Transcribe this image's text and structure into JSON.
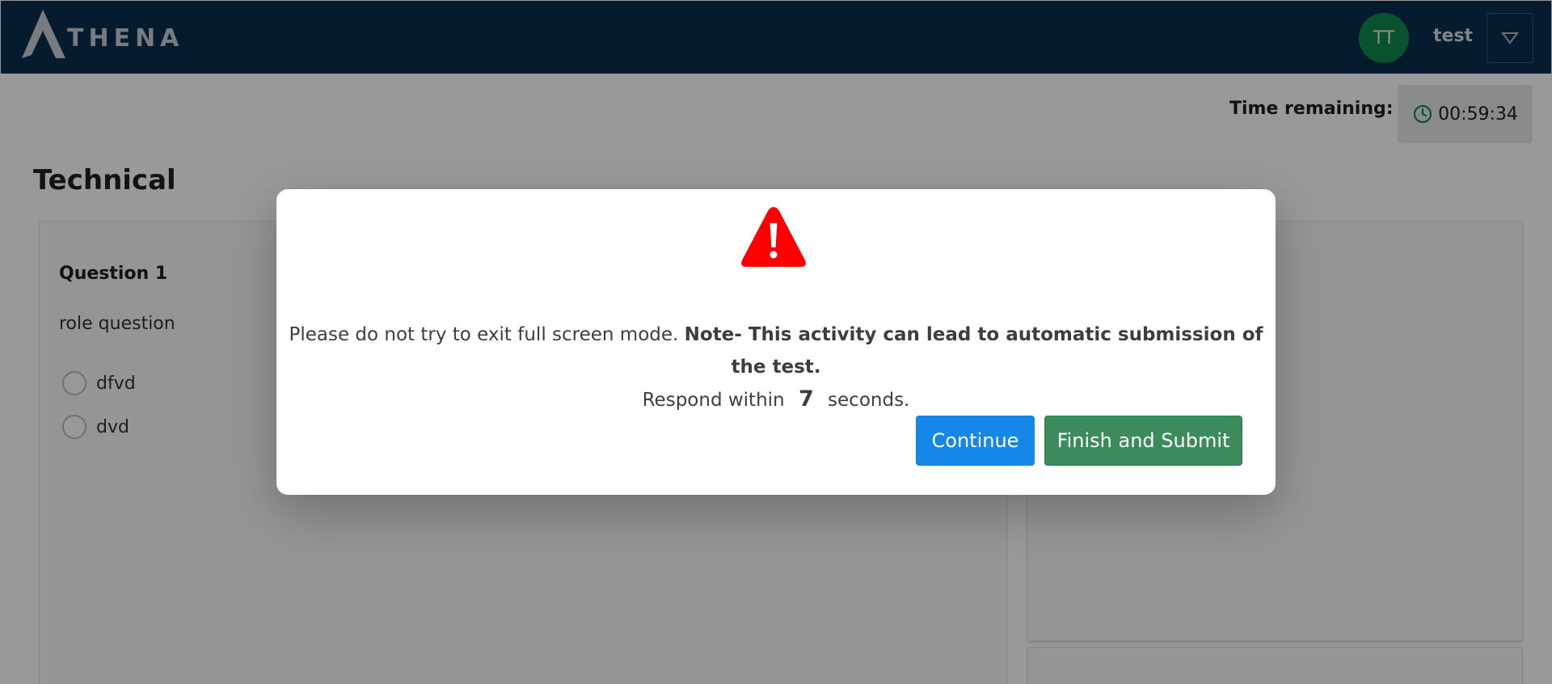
{
  "header": {
    "logo_text": "THENA",
    "logo_letter": "A",
    "avatar_initials": "TT",
    "username": "test"
  },
  "timer": {
    "label": "Time remaining:",
    "value": "00:59:34"
  },
  "section": {
    "title": "Technical"
  },
  "question": {
    "title": "Question 1",
    "text": "role question",
    "options": [
      "dfvd",
      "dvd"
    ]
  },
  "modal": {
    "message_plain": "Please do not try to exit full screen mode.",
    "message_bold": "Note- This activity can lead to automatic submission of the test.",
    "respond_prefix": "Respond within",
    "countdown": "7",
    "respond_suffix": "seconds.",
    "continue_label": "Continue",
    "submit_label": "Finish and Submit"
  },
  "colors": {
    "header_bg": "#0b2e4b",
    "avatar_bg": "#0e8a4c",
    "continue_bg": "#1487e9",
    "submit_bg": "#3c8b5c",
    "warning": "#ff0000"
  }
}
